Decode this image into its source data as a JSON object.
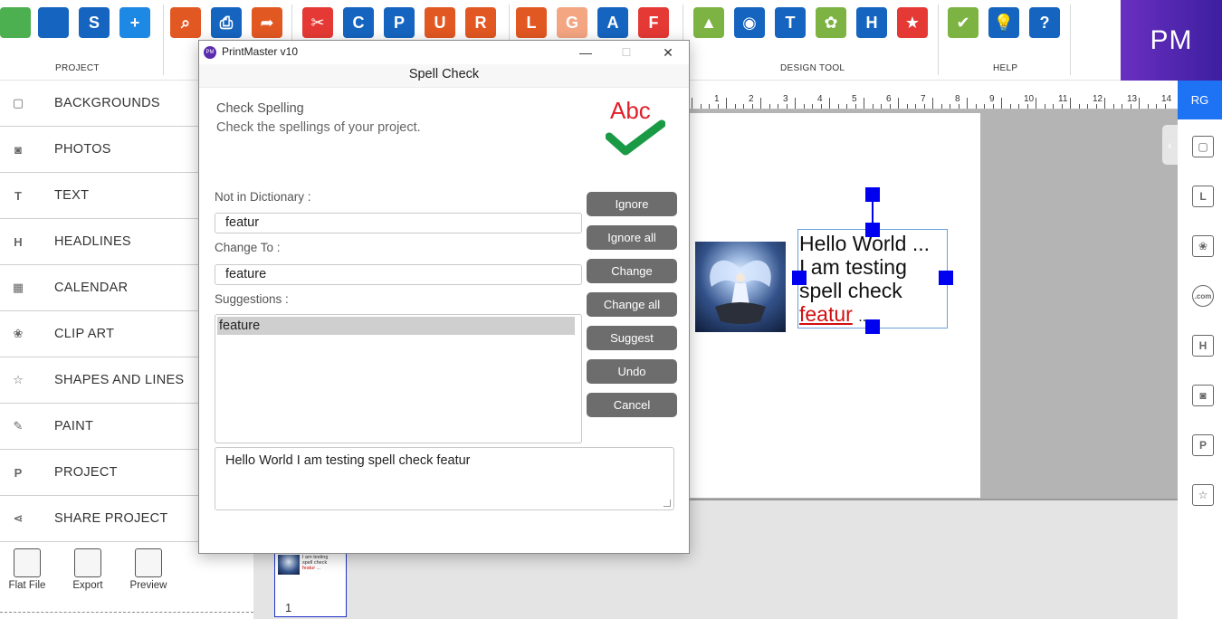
{
  "toolbar": {
    "groups": {
      "project": "PROJECT",
      "design_tool": "DESIGN TOOL",
      "help": "HELP"
    },
    "icons": [
      {
        "name": "new-page-icon",
        "glyph": "",
        "color": "#4caf50"
      },
      {
        "name": "open-folder-icon",
        "glyph": "",
        "color": "#1565c0"
      },
      {
        "name": "save-icon",
        "glyph": "S",
        "color": "#1565c0"
      },
      {
        "name": "add-page-icon",
        "glyph": "+",
        "color": "#1e88e5"
      },
      {
        "name": "preview-icon",
        "glyph": "⌕",
        "color": "#e25822"
      },
      {
        "name": "print-icon",
        "glyph": "⎙",
        "color": "#1565c0"
      },
      {
        "name": "export-icon",
        "glyph": "➦",
        "color": "#e25822"
      },
      {
        "name": "cut-icon",
        "glyph": "✂",
        "color": "#e53935"
      },
      {
        "name": "copy-icon",
        "glyph": "C",
        "color": "#1565c0"
      },
      {
        "name": "paste-icon",
        "glyph": "P",
        "color": "#1565c0"
      },
      {
        "name": "undo-icon",
        "glyph": "U",
        "color": "#e25822"
      },
      {
        "name": "redo-icon",
        "glyph": "R",
        "color": "#e25822"
      },
      {
        "name": "layers-icon",
        "glyph": "L",
        "color": "#e25822"
      },
      {
        "name": "grid-icon",
        "glyph": "G",
        "color": "#f4a582"
      },
      {
        "name": "align-icon",
        "glyph": "A",
        "color": "#1565c0"
      },
      {
        "name": "frame-icon",
        "glyph": "F",
        "color": "#e53935"
      },
      {
        "name": "image-icon",
        "glyph": "▲",
        "color": "#7cb342"
      },
      {
        "name": "camera-icon",
        "glyph": "◉",
        "color": "#1565c0"
      },
      {
        "name": "text-icon",
        "glyph": "T",
        "color": "#1565c0"
      },
      {
        "name": "clipart-flower-icon",
        "glyph": "✿",
        "color": "#7cb342"
      },
      {
        "name": "headline-icon",
        "glyph": "H",
        "color": "#1565c0"
      },
      {
        "name": "star-badge-icon",
        "glyph": "★",
        "color": "#e53935"
      },
      {
        "name": "spell-check-icon",
        "glyph": "✔",
        "color": "#7cb342"
      },
      {
        "name": "tips-bulb-icon",
        "glyph": "💡",
        "color": "#1565c0"
      },
      {
        "name": "help-question-icon",
        "glyph": "?",
        "color": "#1565c0"
      }
    ],
    "logo_text": "PM"
  },
  "sidebar": {
    "items": [
      {
        "label": "BACKGROUNDS",
        "icon": "backgrounds-icon",
        "glyph": "▢"
      },
      {
        "label": "PHOTOS",
        "icon": "camera-icon",
        "glyph": "◙"
      },
      {
        "label": "TEXT",
        "icon": "text-icon",
        "glyph": "T"
      },
      {
        "label": "HEADLINES",
        "icon": "headline-icon",
        "glyph": "H"
      },
      {
        "label": "CALENDAR",
        "icon": "calendar-icon",
        "glyph": "▦"
      },
      {
        "label": "CLIP ART",
        "icon": "lotus-icon",
        "glyph": "❀"
      },
      {
        "label": "SHAPES AND LINES",
        "icon": "star-outline-icon",
        "glyph": "☆"
      },
      {
        "label": "PAINT",
        "icon": "paintbrush-icon",
        "glyph": "✎"
      },
      {
        "label": "PROJECT",
        "icon": "project-icon",
        "glyph": "P"
      },
      {
        "label": "SHARE PROJECT",
        "icon": "share-icon",
        "glyph": "⋖"
      }
    ],
    "bottom_tools": [
      {
        "label": "Flat File",
        "icon": "flat-file-icon"
      },
      {
        "label": "Export",
        "icon": "export-icon"
      },
      {
        "label": "Preview",
        "icon": "preview-icon"
      }
    ]
  },
  "ruler": {
    "ticks": [
      "1",
      "2",
      "3",
      "4",
      "5",
      "6",
      "7",
      "8",
      "9",
      "10",
      "11",
      "12",
      "13",
      "14"
    ]
  },
  "canvas": {
    "text_lines": [
      "Hello World ...",
      "I am testing",
      "spell check",
      "featur",
      "..."
    ],
    "misspelled_color": "#d01010",
    "thumbnail_number": "1",
    "thumb_text": [
      "I am testing",
      "spell check",
      "featur ..."
    ]
  },
  "right_rail": {
    "badge": "RG",
    "icons": [
      {
        "name": "backgrounds-icon",
        "glyph": "▢"
      },
      {
        "name": "layers-icon",
        "glyph": "L"
      },
      {
        "name": "lotus-icon",
        "glyph": "❀"
      },
      {
        "name": "cloud-com-icon",
        "glyph": ".com"
      },
      {
        "name": "headline-icon",
        "glyph": "H"
      },
      {
        "name": "camera-icon",
        "glyph": "◙"
      },
      {
        "name": "project-icon",
        "glyph": "P"
      },
      {
        "name": "star-outline-icon",
        "glyph": "☆"
      }
    ]
  },
  "dialog": {
    "app_title": "PrintMaster v10",
    "app_icon_text": "PM",
    "window_controls": {
      "minimize": "—",
      "maximize": "☐",
      "close": "✕"
    },
    "header": "Spell Check",
    "heading": "Check Spelling",
    "description": "Check the spellings of your project.",
    "logo_text": "Abc",
    "not_in_dictionary_label": "Not in Dictionary :",
    "not_in_dictionary_value": "featur",
    "change_to_label": "Change To :",
    "change_to_value": "feature",
    "suggestions_label": "Suggestions :",
    "suggestions": [
      "feature"
    ],
    "buttons": {
      "ignore": "Ignore",
      "ignore_all": "Ignore all",
      "change": "Change",
      "change_all": "Change all",
      "suggest": "Suggest",
      "undo": "Undo",
      "cancel": "Cancel"
    },
    "context_text": "Hello World I am testing spell check featur"
  }
}
